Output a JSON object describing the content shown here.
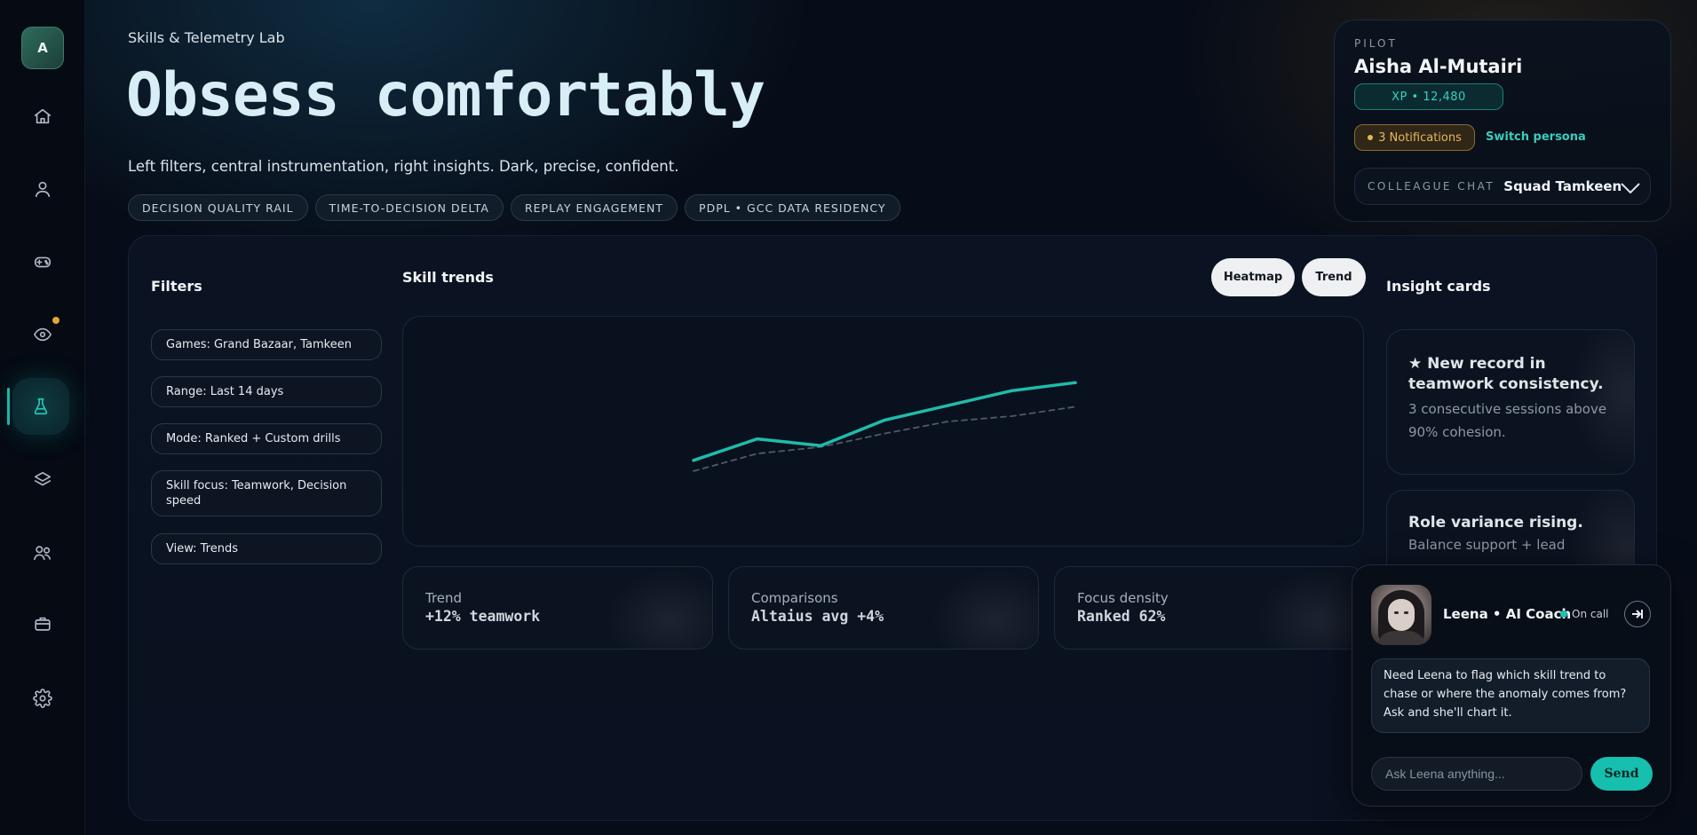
{
  "sidebar": {
    "avatar_initial": "A",
    "items": [
      {
        "icon": "home-icon"
      },
      {
        "icon": "user-icon"
      },
      {
        "icon": "gamepad-icon"
      },
      {
        "icon": "eye-icon",
        "has_notification": true
      },
      {
        "icon": "flask-icon",
        "active": true
      },
      {
        "icon": "layers-icon"
      },
      {
        "icon": "users-icon"
      },
      {
        "icon": "briefcase-icon"
      },
      {
        "icon": "gear-icon"
      }
    ]
  },
  "hero": {
    "eyebrow": "Skills & Telemetry Lab",
    "title": "Obsess comfortably",
    "subtitle": "Left filters, central instrumentation, right insights. Dark, precise, confident.",
    "chips": [
      "DECISION QUALITY RAIL",
      "TIME-TO-DECISION DELTA",
      "REPLAY ENGAGEMENT",
      "PDPL • GCC DATA RESIDENCY"
    ]
  },
  "pilot": {
    "label": "PILOT",
    "name": "Aisha Al-Mutairi",
    "xp": "XP • 12,480",
    "notifications": "3 Notifications",
    "switch_label": "Switch persona",
    "chat_label": "COLLEAGUE CHAT",
    "chat_value": "Squad Tamkeen"
  },
  "filters": {
    "title": "Filters",
    "items": [
      "Games: Grand Bazaar, Tamkeen",
      "Range: Last 14 days",
      "Mode: Ranked + Custom drills",
      "Skill focus: Teamwork, Decision speed",
      "View: Trends"
    ]
  },
  "trends": {
    "title": "Skill trends",
    "toggles": [
      "Heatmap",
      "Trend"
    ]
  },
  "chart_data": {
    "type": "line",
    "title": "",
    "xlabel": "",
    "ylabel": "",
    "grid": false,
    "x": [
      1,
      2,
      3,
      4,
      5,
      6,
      7
    ],
    "ylim": [
      0,
      100
    ],
    "series": [
      {
        "color": "#1fbcaa",
        "style": "solid",
        "values": [
          22,
          38,
          33,
          52,
          63,
          74,
          80
        ]
      },
      {
        "color": "#4f5a66",
        "style": "dashed",
        "values": [
          14,
          27,
          32,
          42,
          51,
          55,
          62
        ]
      }
    ]
  },
  "metrics": [
    {
      "label": "Trend",
      "value": "+12% teamwork"
    },
    {
      "label": "Comparisons",
      "value": "Altaius avg +4%"
    },
    {
      "label": "Focus density",
      "value": "Ranked 62%"
    }
  ],
  "insights": {
    "title": "Insight cards",
    "cards": [
      {
        "title": "★ New record in teamwork consistency.",
        "body": "3 consecutive sessions above 90% cohesion."
      },
      {
        "title": "Role variance rising.",
        "body": "Balance support + lead"
      }
    ]
  },
  "coach": {
    "name": "Leena • AI Coach",
    "status": "On call",
    "message": "Need Leena to flag which skill trend to chase or where the anomaly comes from? Ask and she'll chart it.",
    "input_placeholder": "Ask Leena anything...",
    "send_label": "Send"
  },
  "colors": {
    "accent": "#1fbcaa",
    "warning": "#e8b659",
    "background": "#070d18"
  }
}
